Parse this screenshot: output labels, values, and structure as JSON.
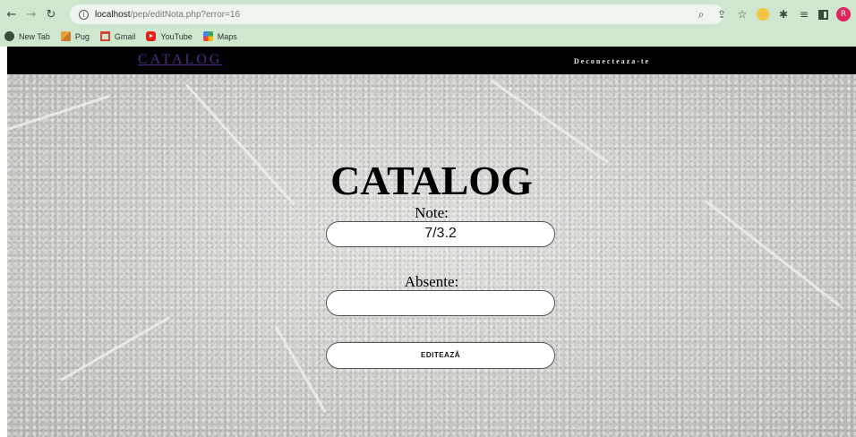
{
  "browser": {
    "url_host": "localhost",
    "url_path": "/pep/editNota.php?error=16",
    "profile_initial": "R",
    "bookmarks": [
      {
        "label": "New Tab",
        "icon": "globe-icon"
      },
      {
        "label": "Pug",
        "icon": "pug-icon"
      },
      {
        "label": "Gmail",
        "icon": "gmail-icon"
      },
      {
        "label": "YouTube",
        "icon": "youtube-icon"
      },
      {
        "label": "Maps",
        "icon": "maps-icon"
      }
    ]
  },
  "nav": {
    "logo": "CATALOG",
    "logout": "Deconecteaza-te"
  },
  "main": {
    "title": "CATALOG",
    "grades_label": "Note:",
    "grades_value": "7/3.2",
    "absences_label": "Absente:",
    "absences_value": "",
    "submit_label": "EDITEAZĂ"
  },
  "colors": {
    "browser_chrome": "#cfe6cf",
    "navbar": "#000000",
    "logo_link": "#4b2a88"
  }
}
